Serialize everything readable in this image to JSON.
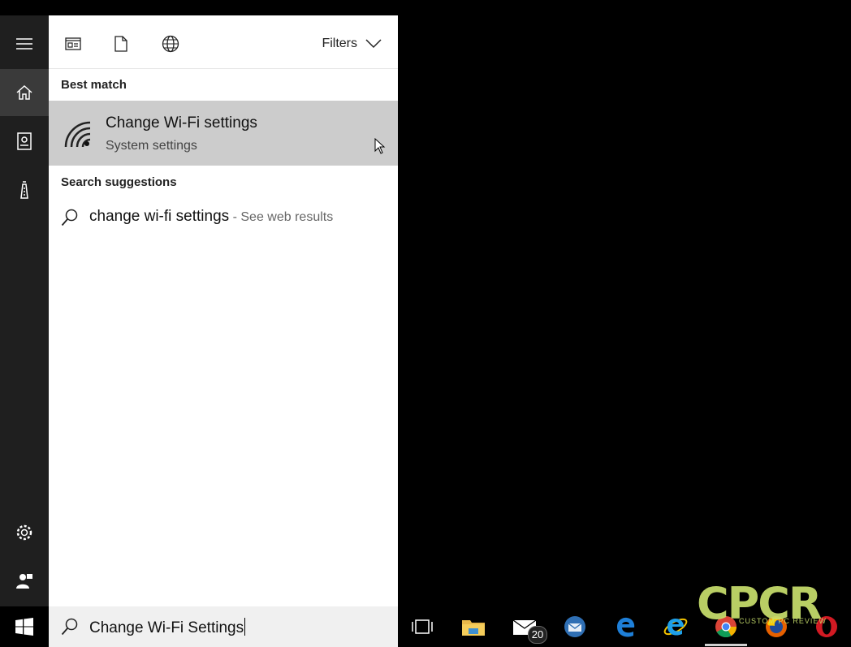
{
  "toolbar": {
    "filters_label": "Filters",
    "icons": [
      "apps-icon",
      "document-icon",
      "web-icon"
    ]
  },
  "best_match": {
    "heading": "Best match",
    "title": "Change Wi-Fi settings",
    "subtitle": "System settings",
    "icon": "wifi-icon"
  },
  "suggestions": {
    "heading": "Search suggestions",
    "items": [
      {
        "query": "change wi-fi settings",
        "suffix": " - See web results"
      }
    ]
  },
  "search": {
    "value": "Change Wi-Fi Settings"
  },
  "rail": {
    "items": [
      "hamburger-menu-icon",
      "home-icon",
      "notebook-icon",
      "devices-icon",
      "settings-icon",
      "feedback-icon"
    ]
  },
  "taskbar": {
    "mail_badge": "20",
    "apps": [
      "task-view-icon",
      "file-explorer-icon",
      "mail-icon",
      "thunderbird-icon",
      "edge-icon",
      "internet-explorer-icon",
      "chrome-icon",
      "firefox-icon",
      "opera-icon"
    ]
  },
  "watermark": {
    "logo": "CPCR",
    "text": "CUSTOM PC REVIEW"
  },
  "colors": {
    "rail_bg": "#1f1f1f",
    "panel_bg": "#ffffff",
    "selected_bg": "#cccccc",
    "watermark": "#c9e06d"
  }
}
